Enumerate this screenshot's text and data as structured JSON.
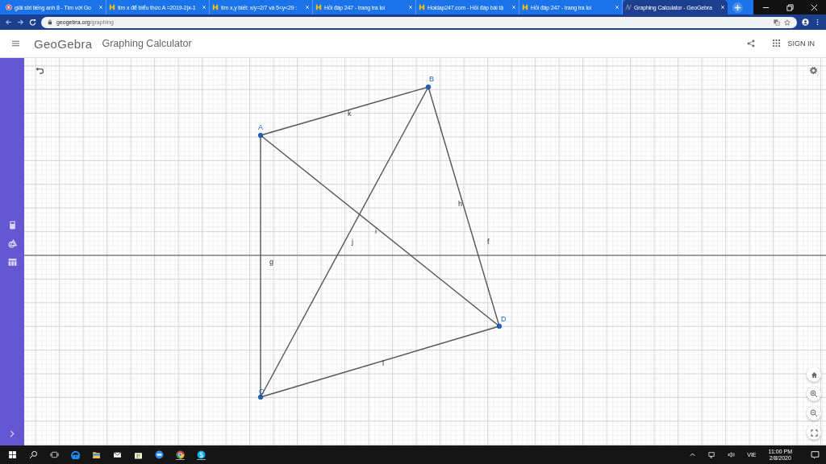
{
  "browser": {
    "tabs": [
      {
        "title": "giải sbt tiếng anh 8 - Tìm với Go",
        "kind": "google",
        "selected": false
      },
      {
        "title": "tìm x để biểu thức A =2019-2|x-1",
        "kind": "hoidap",
        "selected": false
      },
      {
        "title": "tìm x,y biết: x/y=2/7 và 5<y<29 :",
        "kind": "hoidap",
        "selected": false
      },
      {
        "title": "Hỏi đáp 247 - trang tra loi",
        "kind": "hoidap",
        "selected": false
      },
      {
        "title": "Hoidap247.com - Hỏi đáp bài tậ",
        "kind": "hoidap",
        "selected": false
      },
      {
        "title": "Hỏi đáp 247 - trang tra loi",
        "kind": "hoidap",
        "selected": false
      },
      {
        "title": "Graphing Calculator - GeoGebra",
        "kind": "geogebra",
        "selected": true
      }
    ],
    "url_host": "geogebra.org",
    "url_path": "/graphing"
  },
  "header": {
    "logo": "GeoGebra",
    "title": "Graphing Calculator",
    "sign_in": "SIGN IN"
  },
  "canvas": {
    "points": [
      "A",
      "B",
      "D",
      "C"
    ],
    "segments": [
      {
        "label": "k"
      },
      {
        "label": "h"
      },
      {
        "label": "f"
      },
      {
        "label": "i"
      },
      {
        "label": "j"
      },
      {
        "label": "g"
      },
      {
        "label": "l"
      }
    ]
  },
  "taskbar": {
    "language": "VIE",
    "time": "11:00 PM",
    "date": "2/8/2020"
  }
}
